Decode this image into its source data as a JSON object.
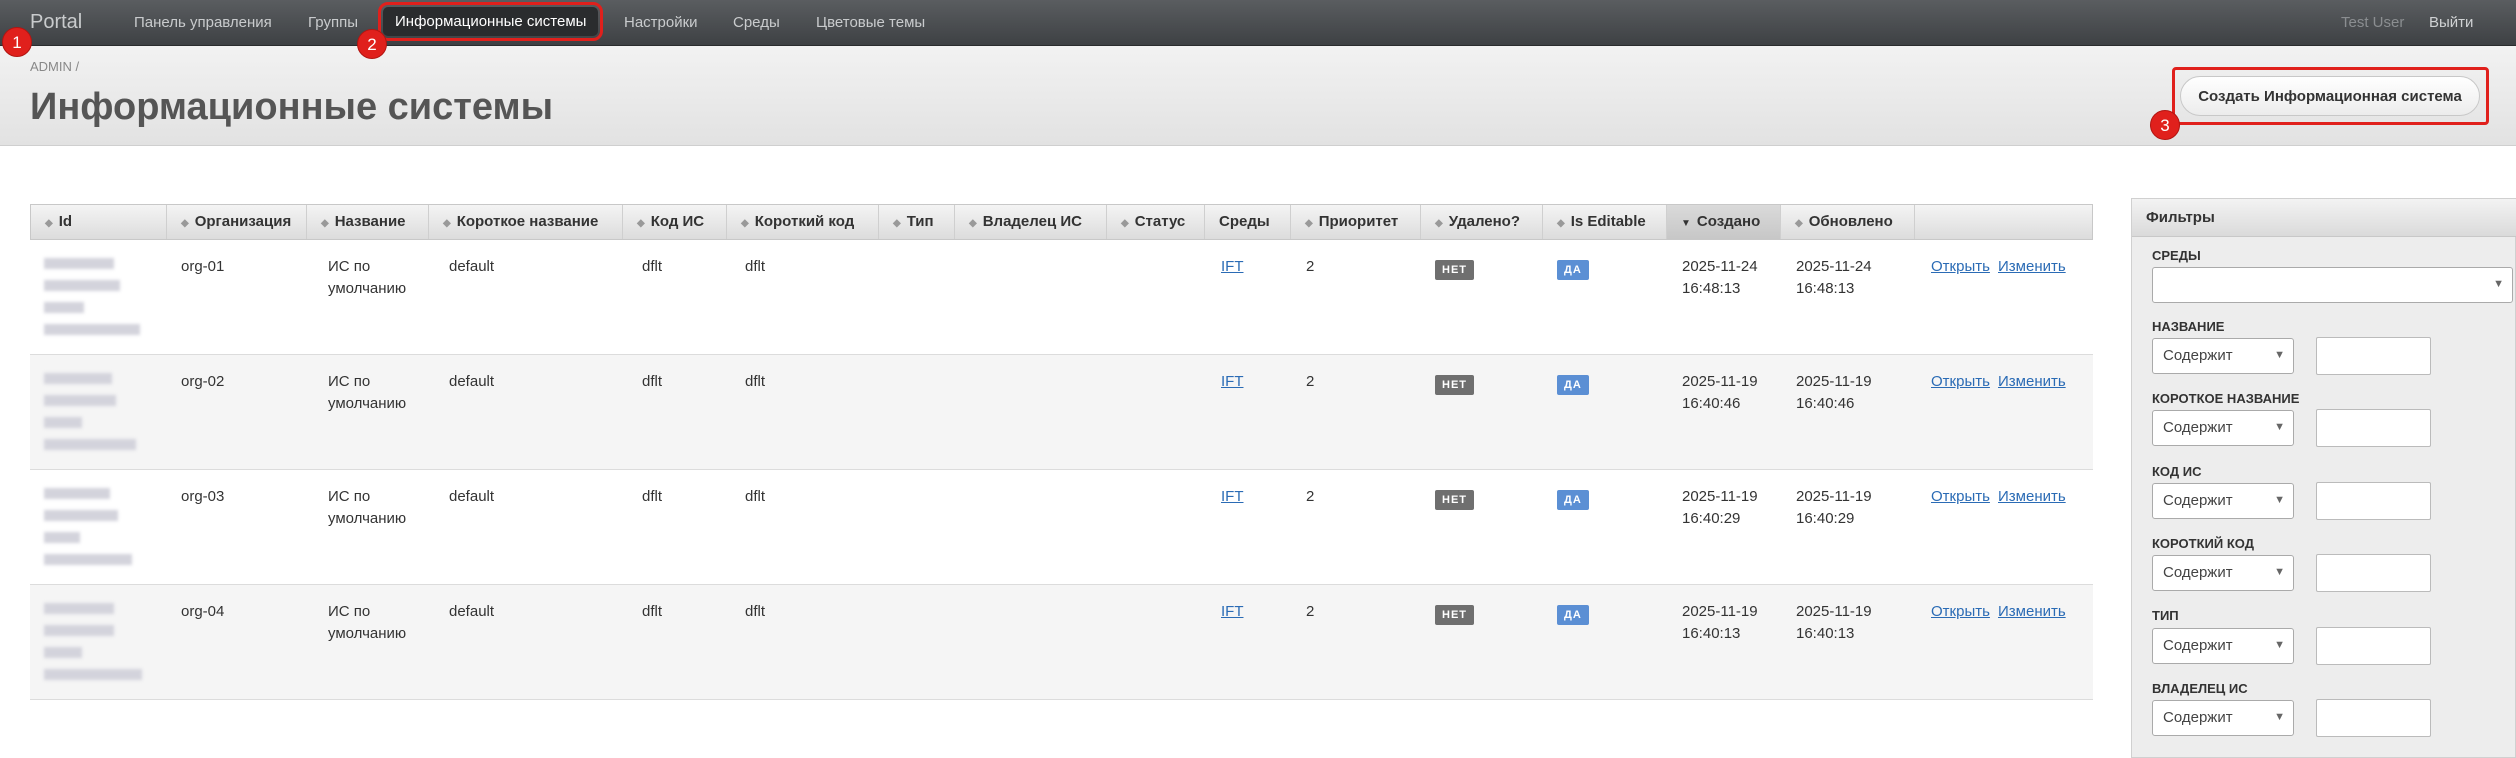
{
  "nav": {
    "brand": "Portal",
    "items": [
      "Панель управления",
      "Группы",
      "Информационные системы",
      "Настройки",
      "Среды",
      "Цветовые темы"
    ],
    "user": "Test User",
    "logout": "Выйти"
  },
  "header": {
    "breadcrumb": "ADMIN  /",
    "title": "Информационные системы",
    "create_button": "Создать Информационная система"
  },
  "badges": [
    "1",
    "2",
    "3"
  ],
  "table": {
    "columns": [
      "Id",
      "Организация",
      "Название",
      "Короткое название",
      "Код ИС",
      "Короткий код",
      "Тип",
      "Владелец ИС",
      "Статус",
      "Среды",
      "Приоритет",
      "Удалено?",
      "Is Editable",
      "Создано",
      "Обновлено"
    ],
    "rows": [
      {
        "org": "org-01",
        "name_l1": "ИС по",
        "name_l2": "умолчанию",
        "short_name": "default",
        "code": "dflt",
        "short_code": "dflt",
        "env": "IFT",
        "priority": "2",
        "deleted": "НЕТ",
        "editable": "ДА",
        "created_date": "2025-11-24",
        "created_time": "16:48:13",
        "updated_date": "2025-11-24",
        "updated_time": "16:48:13",
        "open": "Открыть",
        "edit": "Изменить"
      },
      {
        "org": "org-02",
        "name_l1": "ИС по",
        "name_l2": "умолчанию",
        "short_name": "default",
        "code": "dflt",
        "short_code": "dflt",
        "env": "IFT",
        "priority": "2",
        "deleted": "НЕТ",
        "editable": "ДА",
        "created_date": "2025-11-19",
        "created_time": "16:40:46",
        "updated_date": "2025-11-19",
        "updated_time": "16:40:46",
        "open": "Открыть",
        "edit": "Изменить"
      },
      {
        "org": "org-03",
        "name_l1": "ИС по",
        "name_l2": "умолчанию",
        "short_name": "default",
        "code": "dflt",
        "short_code": "dflt",
        "env": "IFT",
        "priority": "2",
        "deleted": "НЕТ",
        "editable": "ДА",
        "created_date": "2025-11-19",
        "created_time": "16:40:29",
        "updated_date": "2025-11-19",
        "updated_time": "16:40:29",
        "open": "Открыть",
        "edit": "Изменить"
      },
      {
        "org": "org-04",
        "name_l1": "ИС по",
        "name_l2": "умолчанию",
        "short_name": "default",
        "code": "dflt",
        "short_code": "dflt",
        "env": "IFT",
        "priority": "2",
        "deleted": "НЕТ",
        "editable": "ДА",
        "created_date": "2025-11-19",
        "created_time": "16:40:13",
        "updated_date": "2025-11-19",
        "updated_time": "16:40:13",
        "open": "Открыть",
        "edit": "Изменить"
      }
    ]
  },
  "filters": {
    "title": "Фильтры",
    "envs_label": "Среды",
    "fields": [
      {
        "label": "Название",
        "operator": "Содержит"
      },
      {
        "label": "Короткое название",
        "operator": "Содержит"
      },
      {
        "label": "Код ИС",
        "operator": "Содержит"
      },
      {
        "label": "Короткий код",
        "operator": "Содержит"
      },
      {
        "label": "Тип",
        "operator": "Содержит"
      },
      {
        "label": "Владелец ИС",
        "operator": "Содержит"
      }
    ]
  },
  "colors": {
    "accent_red": "#e0201c",
    "link": "#2a6bb5",
    "tag_no": "#6f6f6f",
    "tag_yes": "#5b8fd4"
  }
}
